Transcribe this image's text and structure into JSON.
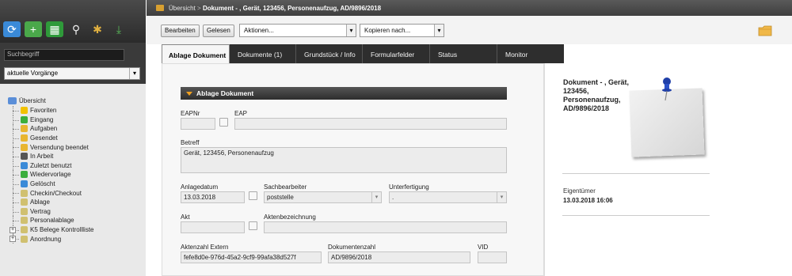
{
  "sidebar": {
    "search_placeholder": "Suchbegriff",
    "filter_selected": "aktuelle Vorgänge",
    "tree_root": "Übersicht",
    "items": [
      {
        "label": "Favoriten",
        "icon": "star-icon",
        "color": "#f2c200"
      },
      {
        "label": "Eingang",
        "icon": "inbox-icon",
        "color": "#3cae3c"
      },
      {
        "label": "Aufgaben",
        "icon": "tasks-icon",
        "color": "#e8b530"
      },
      {
        "label": "Gesendet",
        "icon": "sent-icon",
        "color": "#e8b530"
      },
      {
        "label": "Versendung beendet",
        "icon": "sent-done-icon",
        "color": "#e8b530"
      },
      {
        "label": "In Arbeit",
        "icon": "in-progress-icon",
        "color": "#555555"
      },
      {
        "label": "Zuletzt benutzt",
        "icon": "recent-icon",
        "color": "#3a8ad8"
      },
      {
        "label": "Wiedervorlage",
        "icon": "resubmit-icon",
        "color": "#3cae3c"
      },
      {
        "label": "Gelöscht",
        "icon": "trash-icon",
        "color": "#3a8ad8"
      },
      {
        "label": "Checkin/Checkout",
        "icon": "checkout-icon",
        "color": "#d0c070"
      },
      {
        "label": "Ablage",
        "icon": "archive-icon",
        "color": "#d0c070"
      },
      {
        "label": "Vertrag",
        "icon": "contract-icon",
        "color": "#d0c070"
      },
      {
        "label": "Personalablage",
        "icon": "personnel-icon",
        "color": "#d0c070"
      },
      {
        "label": "K5 Belege Kontrollliste",
        "icon": "receipts-icon",
        "color": "#d0c070",
        "expandable": true
      },
      {
        "label": "Anordnung",
        "icon": "order-icon",
        "color": "#d0c070",
        "expandable": true
      }
    ]
  },
  "breadcrumb": {
    "parent": "Übersicht",
    "separator": ">",
    "current": "Dokument - , Gerät, 123456, Personenaufzug, AD/9896/2018"
  },
  "actions": {
    "edit": "Bearbeiten",
    "read": "Gelesen",
    "actions_dropdown": "Aktionen...",
    "copy_dropdown": "Kopieren nach..."
  },
  "tabs": [
    {
      "label": "Ablage Dokument",
      "active": true
    },
    {
      "label": "Dokumente (1)"
    },
    {
      "label": "Grundstück / Info"
    },
    {
      "label": "Formularfelder"
    },
    {
      "label": "Status"
    },
    {
      "label": "Monitor"
    }
  ],
  "form": {
    "section_title": "Ablage Dokument",
    "eapnr_label": "EAPNr",
    "eapnr_value": "",
    "eap_label": "EAP",
    "eap_value": "",
    "betreff_label": "Betreff",
    "betreff_value": "Gerät, 123456, Personenaufzug",
    "anlagedatum_label": "Anlagedatum",
    "anlagedatum_value": "13.03.2018",
    "sachbearbeiter_label": "Sachbearbeiter",
    "sachbearbeiter_value": "poststelle",
    "unterfertigung_label": "Unterfertigung",
    "unterfertigung_value": ".",
    "akt_label": "Akt",
    "akt_value": "",
    "aktenbezeichnung_label": "Aktenbezeichnung",
    "aktenbezeichnung_value": "",
    "aktenzahl_extern_label": "Aktenzahl Extern",
    "aktenzahl_extern_value": "fefe8d0e-976d-45a2-9cf9-99afa38d527f",
    "dokumentenzahl_label": "Dokumentenzahl",
    "dokumentenzahl_value": "AD/9896/2018",
    "vid_label": "VID",
    "vid_value": ""
  },
  "details": {
    "title": "Dokument - , Gerät, 123456, Personenaufzug, AD/9896/2018",
    "owner_label": "Eigentümer",
    "owner_value": "13.03.2018 16:06"
  }
}
